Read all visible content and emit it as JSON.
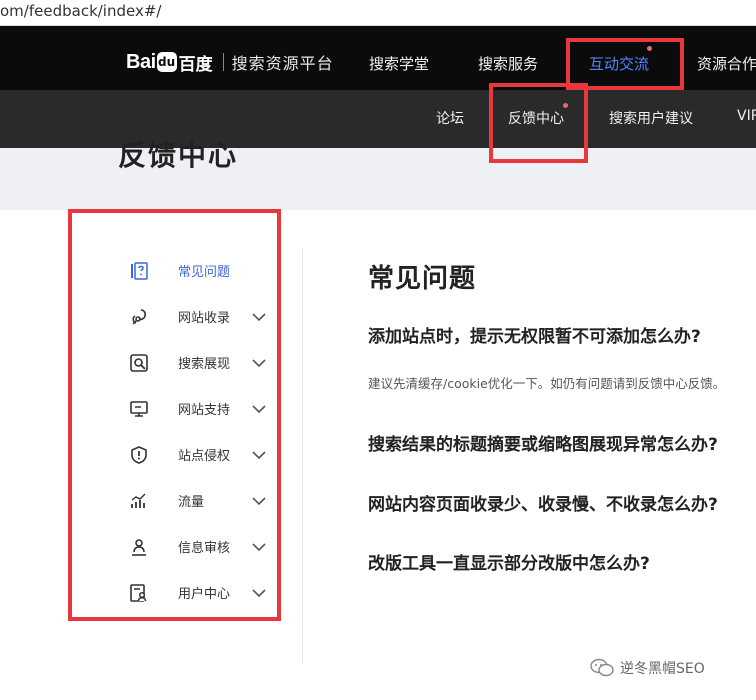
{
  "browser": {
    "url_fragment": "om/feedback/index#/"
  },
  "header": {
    "logo_text": "Bai",
    "logo_paw": "du",
    "logo_cn": "百度",
    "platform_name": "搜索资源平台",
    "nav": [
      "搜索学堂",
      "搜索服务",
      "互动交流",
      "资源合作"
    ]
  },
  "subnav": [
    "论坛",
    "反馈中心",
    "搜索用户建议",
    "VIP"
  ],
  "page_title": "反馈中心",
  "sidebar": {
    "items": [
      {
        "label": "常见问题",
        "icon": "faq-icon",
        "active": true,
        "expandable": false
      },
      {
        "label": "网站收录",
        "icon": "index-icon",
        "active": false,
        "expandable": true
      },
      {
        "label": "搜索展现",
        "icon": "search-display-icon",
        "active": false,
        "expandable": true
      },
      {
        "label": "网站支持",
        "icon": "monitor-icon",
        "active": false,
        "expandable": true
      },
      {
        "label": "站点侵权",
        "icon": "shield-icon",
        "active": false,
        "expandable": true
      },
      {
        "label": "流量",
        "icon": "chart-icon",
        "active": false,
        "expandable": true
      },
      {
        "label": "信息审核",
        "icon": "person-review-icon",
        "active": false,
        "expandable": true
      },
      {
        "label": "用户中心",
        "icon": "user-center-icon",
        "active": false,
        "expandable": true
      }
    ]
  },
  "main": {
    "title": "常见问题",
    "questions": [
      "添加站点时，提示无权限暂不可添加怎么办?",
      "搜索结果的标题摘要或缩略图展现异常怎么办?",
      "网站内容页面收录少、收录慢、不收录怎么办?",
      "改版工具一直显示部分改版中怎么办?"
    ],
    "answer": "建议先清缓存/cookie优化一下。如仍有问题请到反馈中心反馈。"
  },
  "watermark": "逆冬黑帽SEO",
  "colors": {
    "highlight": "#e8383c",
    "active": "#3a66d9",
    "nav_bg": "#0b0b0b",
    "subnav_bg": "#2a2a2a",
    "hero_bg": "#eef0f6"
  }
}
